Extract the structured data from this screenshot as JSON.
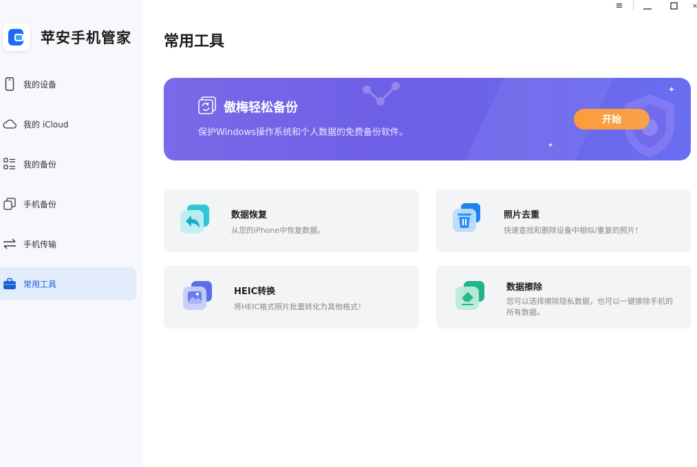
{
  "app": {
    "title": "苹安手机管家"
  },
  "sidebar": {
    "items": [
      {
        "label": "我的设备",
        "icon": "phone-icon"
      },
      {
        "label": "我的 iCloud",
        "icon": "cloud-icon"
      },
      {
        "label": "我的备份",
        "icon": "list-icon"
      },
      {
        "label": "手机备份",
        "icon": "copy-icon"
      },
      {
        "label": "手机传输",
        "icon": "transfer-icon"
      },
      {
        "label": "常用工具",
        "icon": "toolbox-icon",
        "active": true
      }
    ]
  },
  "window_controls": {
    "menu": "≡",
    "minimize": "—",
    "maximize": "☐",
    "close": "✕"
  },
  "main": {
    "title": "常用工具",
    "banner": {
      "title": "傲梅轻松备份",
      "subtitle": "保护Windows操作系统和个人数据的免费备份软件。",
      "button": "开始"
    },
    "tools": [
      {
        "title": "数据恢复",
        "subtitle": "从您的iPhone中恢复数据。",
        "icon": "data-recovery-icon"
      },
      {
        "title": "照片去重",
        "subtitle": "快速查找和删除设备中相似/重复的照片！",
        "icon": "photo-dedup-icon"
      },
      {
        "title": "HEIC转换",
        "subtitle": "将HEIC格式照片批量转化为其他格式！",
        "icon": "heic-convert-icon"
      },
      {
        "title": "数据擦除",
        "subtitle": "您可以选择擦除隐私数据，也可以一键擦除手机的所有数据。",
        "icon": "data-erase-icon"
      }
    ]
  },
  "colors": {
    "accent": "#1c5fd6",
    "banner_start": "#7a6ae9",
    "button_orange": "#ff9a3c"
  }
}
